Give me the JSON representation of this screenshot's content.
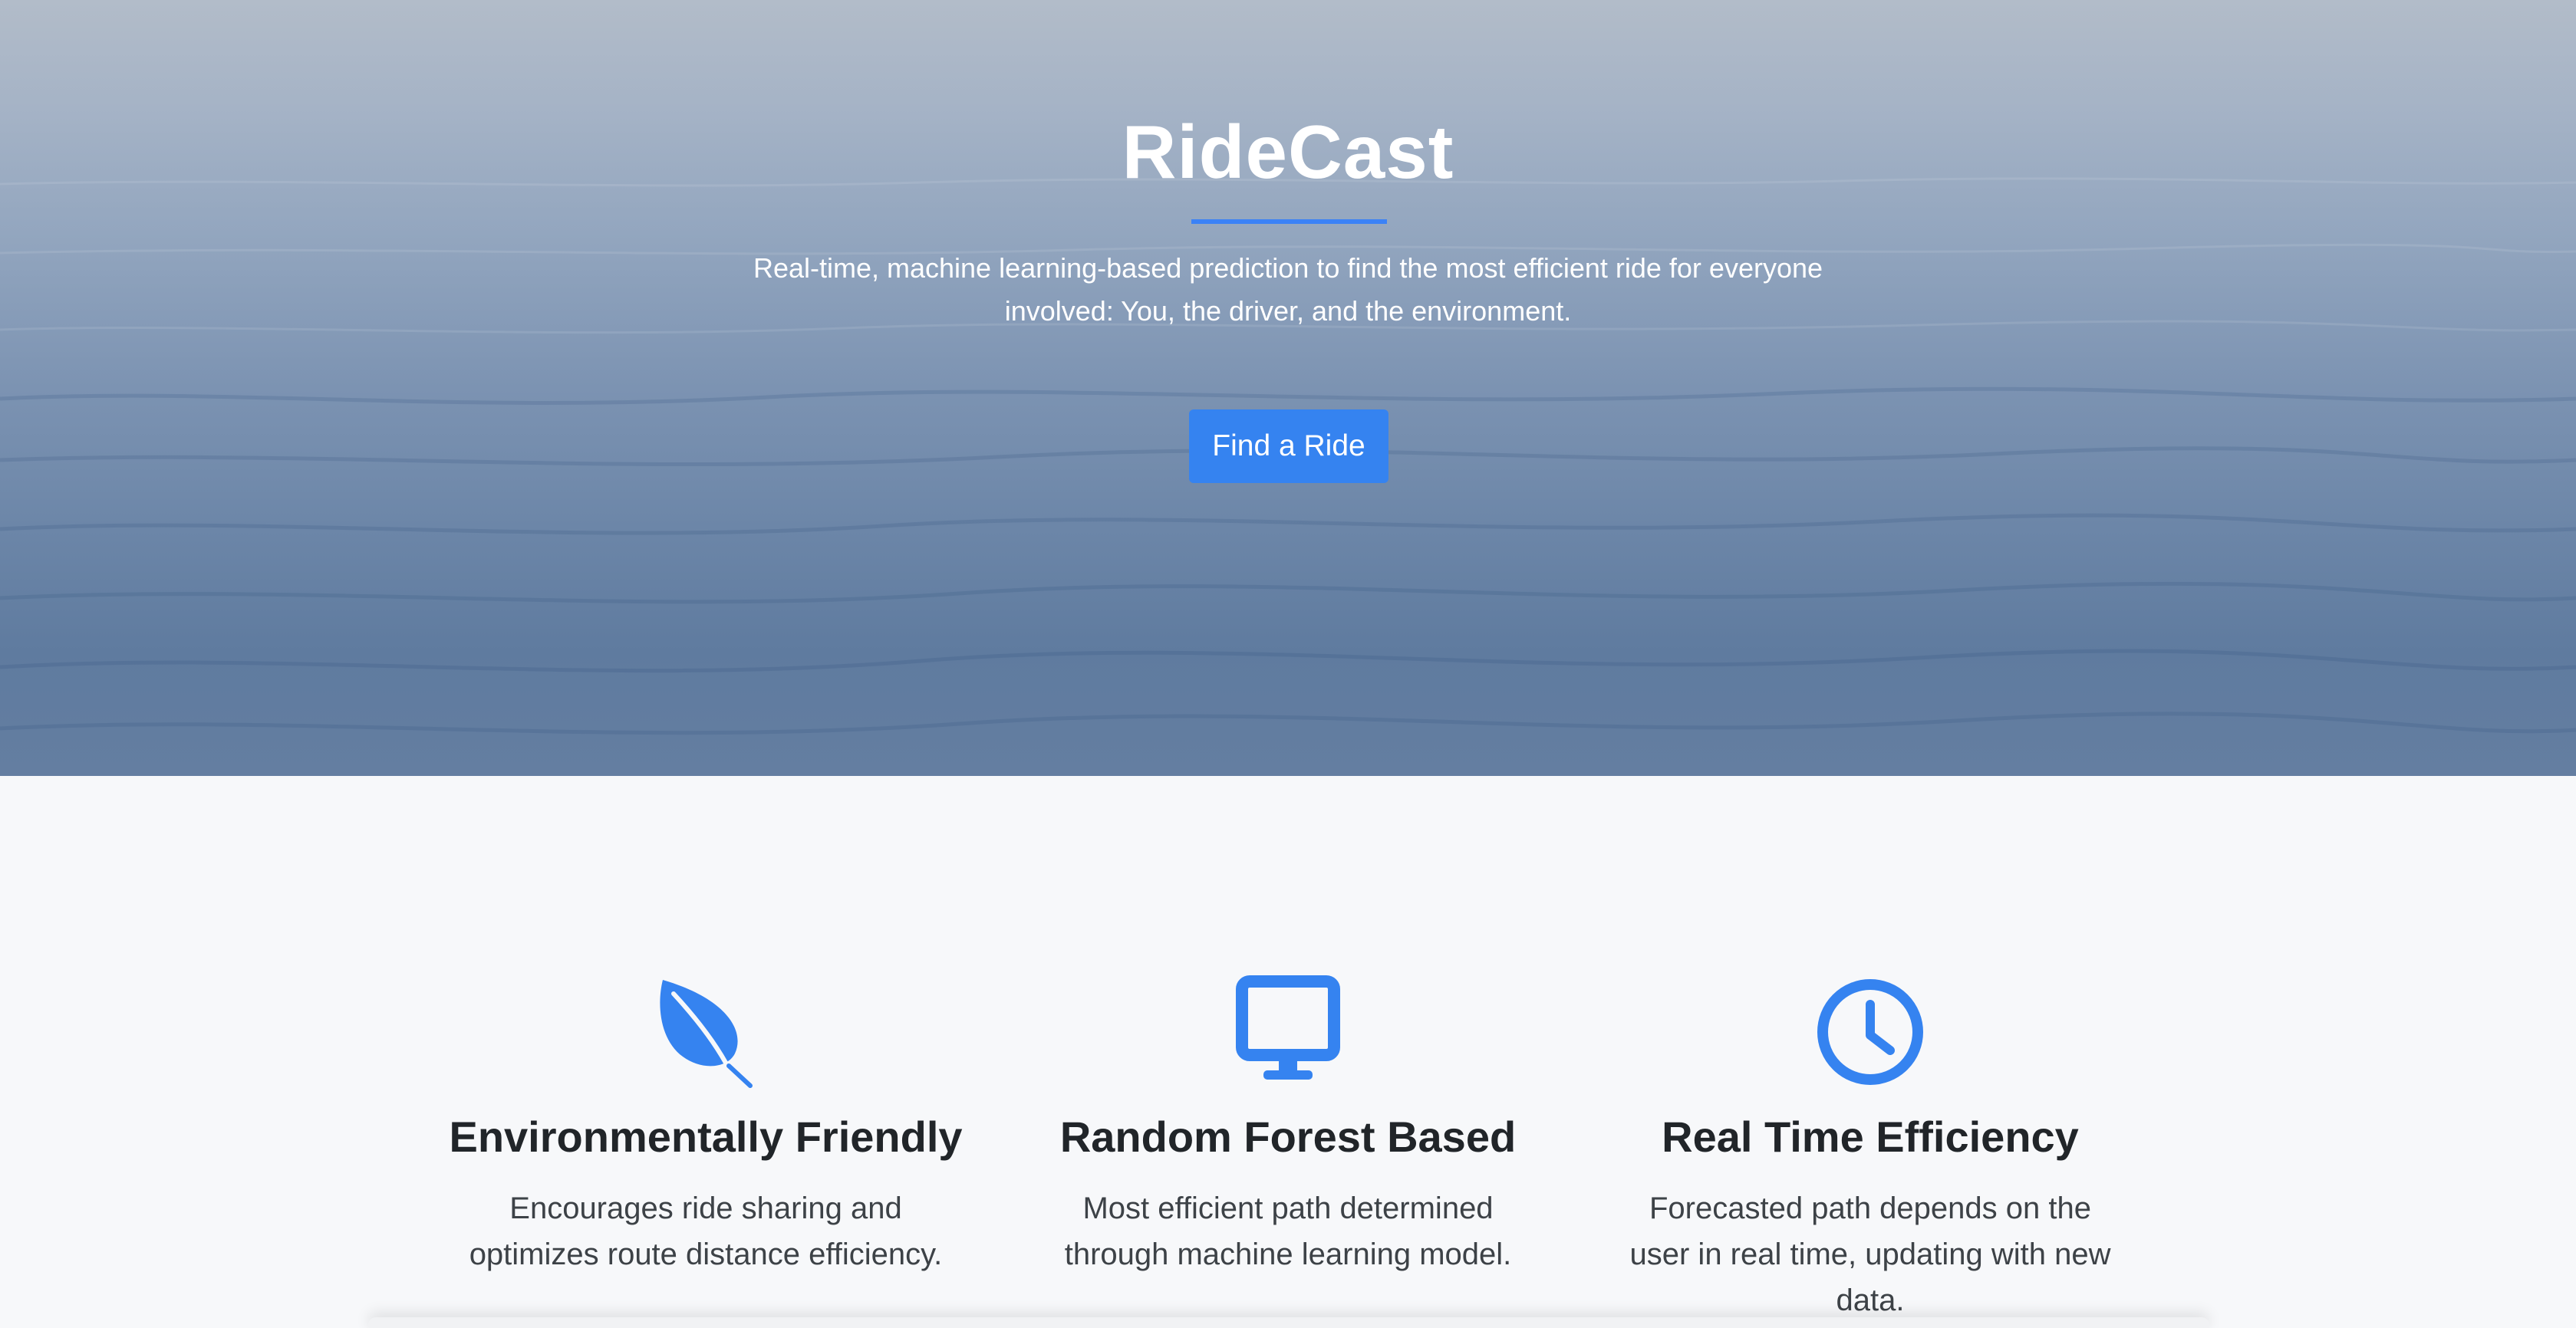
{
  "hero": {
    "title": "RideCast",
    "subtitle": "Real-time, machine learning-based prediction to find the most efficient ride for everyone involved: You, the driver, and the environment.",
    "button_label": "Find a Ride"
  },
  "features": [
    {
      "icon": "leaf-icon",
      "title": "Environmentally Friendly",
      "description": "Encourages ride sharing and optimizes route distance efficiency."
    },
    {
      "icon": "desktop-monitor-icon",
      "title": "Random Forest Based",
      "description": "Most efficient path determined through machine learning model."
    },
    {
      "icon": "clock-icon",
      "title": "Real Time Efficiency",
      "description": "Forecasted path depends on the user in real time, updating with new data."
    }
  ],
  "colors": {
    "accent": "#3583f0",
    "heading": "#212529",
    "body_text": "#3d4247",
    "section_background": "#f7f8fa"
  }
}
